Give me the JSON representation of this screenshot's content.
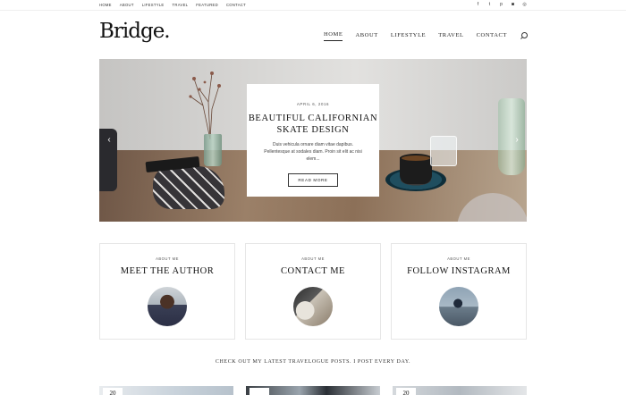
{
  "topbar": {
    "nav": [
      "HOME",
      "ABOUT",
      "LIFESTYLE",
      "TRAVEL",
      "FEATURED",
      "CONTACT"
    ],
    "social": [
      {
        "icon": "facebook-icon",
        "glyph": "f"
      },
      {
        "icon": "twitter-icon",
        "glyph": "t"
      },
      {
        "icon": "pinterest-icon",
        "glyph": "p"
      },
      {
        "icon": "instagram-icon",
        "glyph": "◙"
      },
      {
        "icon": "dribbble-icon",
        "glyph": "◎"
      }
    ]
  },
  "header": {
    "logo": "Bridge.",
    "nav": [
      {
        "label": "HOME",
        "active": true
      },
      {
        "label": "ABOUT",
        "active": false
      },
      {
        "label": "LIFESTYLE",
        "active": false
      },
      {
        "label": "TRAVEL",
        "active": false
      },
      {
        "label": "CONTACT",
        "active": false
      }
    ],
    "search_icon": "search-icon"
  },
  "hero": {
    "date": "APRIL 6, 2016",
    "title_line1": "BEAUTIFUL CALIFORNIAN",
    "title_line2": "SKATE DESIGN",
    "excerpt": "Duis vehicula ornare diam vitae dapibus. Pellentesque at sodales diam. Proin sit elit ac nisi elem...",
    "button": "READ MORE",
    "prev_glyph": "‹",
    "next_glyph": "›"
  },
  "cards": [
    {
      "kicker": "ABOUT ME",
      "title": "MEET THE AUTHOR"
    },
    {
      "kicker": "ABOUT ME",
      "title": "CONTACT ME"
    },
    {
      "kicker": "ABOUT ME",
      "title": "FOLLOW INSTAGRAM"
    }
  ],
  "tagline": "CHECK OUT MY LATEST TRAVELOGUE POSTS. I POST EVERY DAY.",
  "posts": [
    {
      "date": "20"
    },
    {
      "date": ""
    },
    {
      "date": "20"
    }
  ]
}
